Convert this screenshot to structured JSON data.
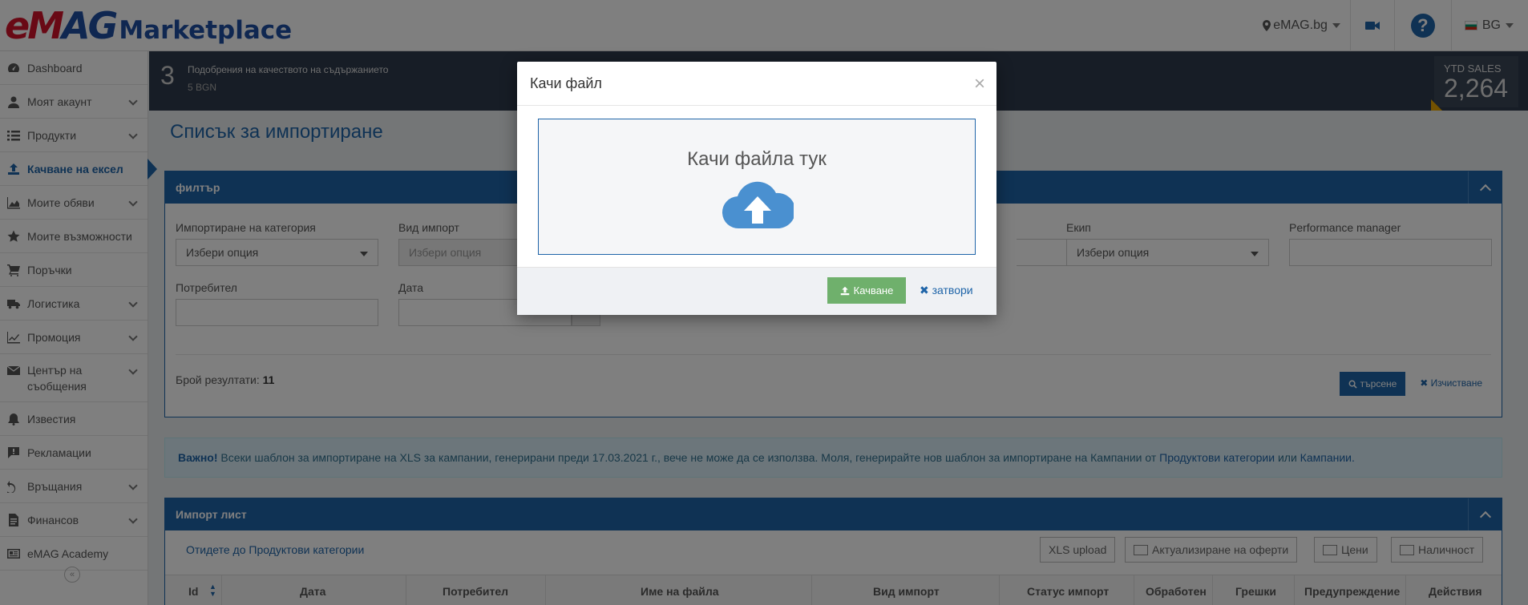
{
  "header": {
    "logo_emag_e": "e",
    "logo_emag_m": "M",
    "logo_emag_ag": "AG",
    "logo_marketplace": "Marketplace",
    "site_select": "eMAG.bg",
    "help": "?",
    "language": "BG"
  },
  "sidebar": {
    "items": [
      {
        "label": "Dashboard"
      },
      {
        "label": "Моят акаунт"
      },
      {
        "label": "Продукти"
      },
      {
        "label": "Качване на ексел"
      },
      {
        "label": "Моите обяви"
      },
      {
        "label": "Моите възможности"
      },
      {
        "label": "Поръчки"
      },
      {
        "label": "Логистика"
      },
      {
        "label": "Промоция"
      },
      {
        "label": "Център на съобщения"
      },
      {
        "label": "Известия"
      },
      {
        "label": "Рекламации"
      },
      {
        "label": "Връщания"
      },
      {
        "label": "Финансов"
      },
      {
        "label": "eMAG Academy"
      }
    ],
    "collapse": "«"
  },
  "stats": {
    "count": "3",
    "title": "Подобрения на качеството на съдържанието",
    "value": "5 BGN",
    "ytd_label": "YTD SALES",
    "ytd_value": "2,264"
  },
  "page": {
    "title": "Списък за импортиране"
  },
  "filter": {
    "title": "филтър",
    "fields": {
      "category_label": "Импортиране на категория",
      "category_value": "Избери опция",
      "import_type_label": "Вид импорт",
      "import_type_value": "Избери опция",
      "team_label": "Екип",
      "team_value": "Избери опция",
      "perf_label": "Performance manager",
      "user_label": "Потребител",
      "date_label": "Дата"
    },
    "results_label": "Брой резултати:",
    "results_count": "11",
    "search_button": "търсене",
    "clear_link": "Изчистване"
  },
  "info": {
    "bold": "Важно!",
    "text": " Всеки шаблон за импортиране на XLS за кампании, генерирани преди 17.03.2021 г., вече не може да се използва. Моля, генерирайте нов шаблон за импортиране на Кампании от ",
    "link1": "Продуктови категории",
    "or": " или ",
    "link2": "Кампании."
  },
  "import_list": {
    "title": "Импорт лист",
    "link": "Отидете до Продуктови категории",
    "buttons": {
      "xls_upload": "XLS upload",
      "update_offers": "Актуализиране на оферти",
      "prices": "Цени",
      "stock": "Наличност"
    },
    "columns": [
      "Id",
      "Дата",
      "Потребител",
      "Име на файла",
      "Вид импорт",
      "Статус импорт",
      "Обработен",
      "Грешки",
      "Предупреждение",
      "Действия"
    ]
  },
  "modal": {
    "title": "Качи файл",
    "close_x": "×",
    "dropzone_text": "Качи файла тук",
    "upload_button": "Качване",
    "close_link": "затвори"
  },
  "colors": {
    "brand_blue": "#1e64a8",
    "brand_red": "#d3132a",
    "upload_green": "#6fb06c",
    "dark_bar": "#2f3b4c",
    "accent_orange": "#e8a400"
  }
}
